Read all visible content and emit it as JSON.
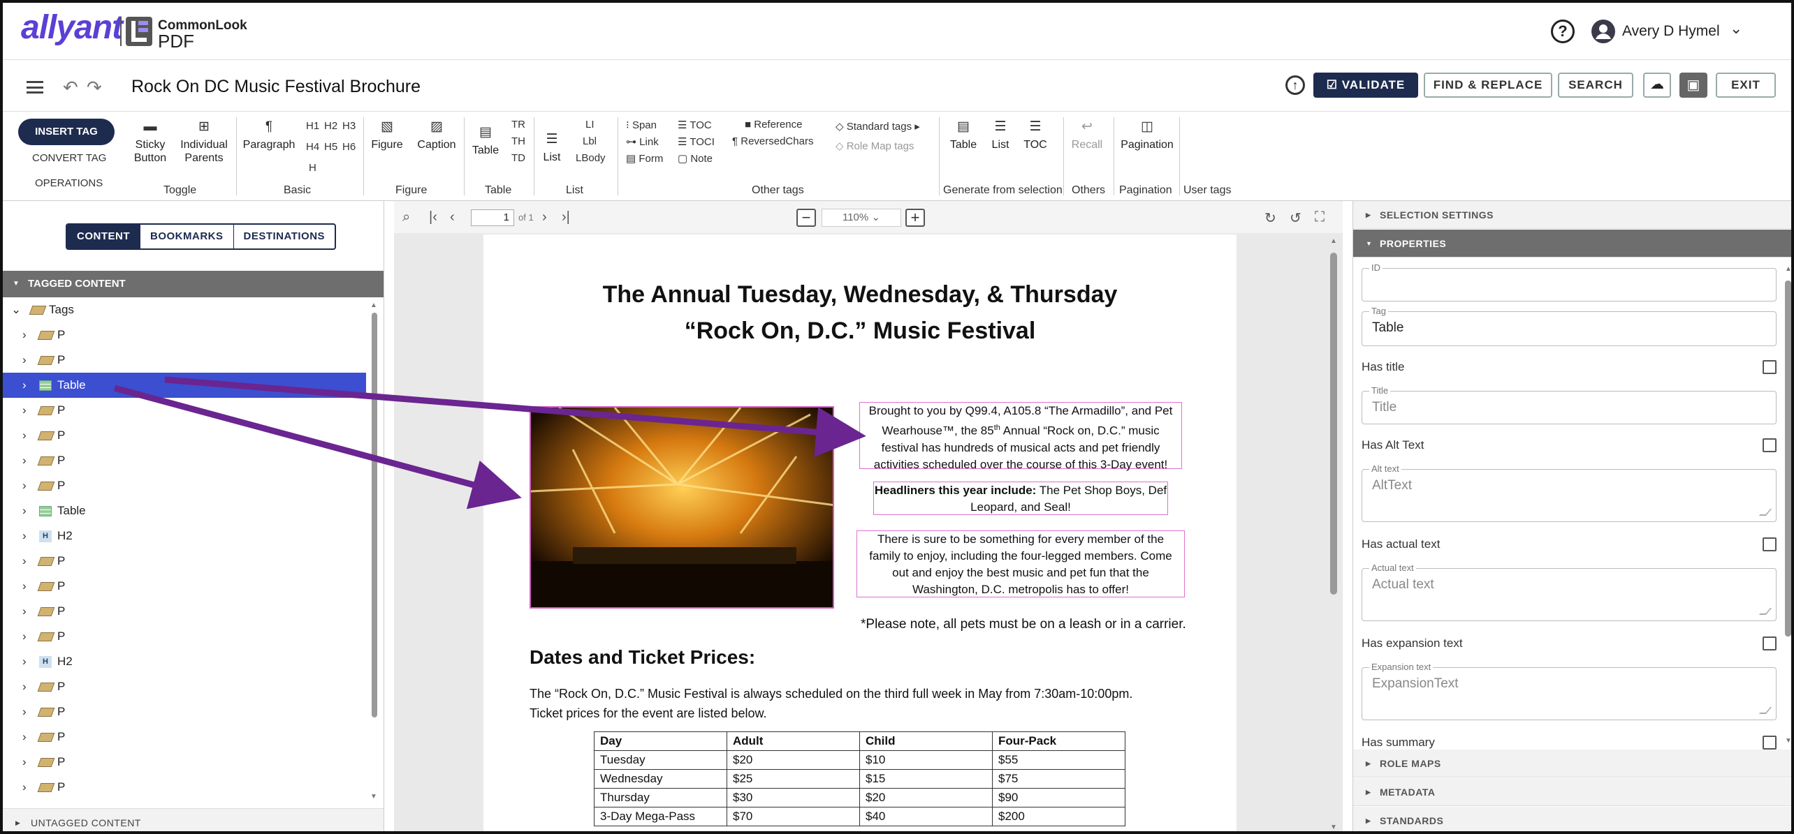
{
  "header": {
    "brand": "allyant",
    "product_top": "CommonLook",
    "product_bottom": "PDF",
    "help_icon": "help-circle-icon",
    "user_name": "Avery D Hymel"
  },
  "titlebar": {
    "doc_title": "Rock On DC Music Festival Brochure",
    "validate": "VALIDATE",
    "find_replace": "FIND & REPLACE",
    "search": "SEARCH",
    "exit": "EXIT"
  },
  "ribbon": {
    "insert_tag": "INSERT TAG",
    "convert_tag": "CONVERT TAG",
    "operations": "OPERATIONS",
    "toggle": {
      "sticky1": "Sticky",
      "sticky2": "Button",
      "indiv1": "Individual",
      "indiv2": "Parents",
      "group": "Toggle"
    },
    "basic": {
      "paragraph": "Paragraph",
      "h1": "H1",
      "h2": "H2",
      "h3": "H3",
      "h4": "H4",
      "h5": "H5",
      "h6": "H6",
      "h": "H",
      "group": "Basic"
    },
    "figure": {
      "figure": "Figure",
      "caption": "Caption",
      "group": "Figure"
    },
    "table": {
      "table": "Table",
      "tr": "TR",
      "th": "TH",
      "td": "TD",
      "group": "Table"
    },
    "list": {
      "list": "List",
      "li": "LI",
      "lbl": "Lbl",
      "lbody": "LBody",
      "group": "List"
    },
    "other": {
      "span": "Span",
      "link": "Link",
      "form": "Form",
      "toc": "TOC",
      "toci": "TOCI",
      "note": "Note",
      "reference": "Reference",
      "reversed": "ReversedChars",
      "standard": "Standard tags",
      "rolemap": "Role Map tags",
      "group": "Other tags"
    },
    "generate": {
      "table": "Table",
      "list": "List",
      "toc": "TOC",
      "group": "Generate from selection"
    },
    "others": {
      "recall": "Recall",
      "group": "Others"
    },
    "pagination": {
      "pagination": "Pagination",
      "group": "Pagination"
    },
    "user_tags": {
      "group": "User tags"
    }
  },
  "left": {
    "tabs": [
      "CONTENT",
      "BOOKMARKS",
      "DESTINATIONS"
    ],
    "tagged": "TAGGED CONTENT",
    "untagged": "UNTAGGED CONTENT",
    "tree": [
      {
        "label": "Tags",
        "kind": "root"
      },
      {
        "label": "P",
        "kind": "tag"
      },
      {
        "label": "P",
        "kind": "tag"
      },
      {
        "label": "Table",
        "kind": "table",
        "selected": true
      },
      {
        "label": "P",
        "kind": "tag"
      },
      {
        "label": "P",
        "kind": "tag"
      },
      {
        "label": "P",
        "kind": "tag"
      },
      {
        "label": "P",
        "kind": "tag"
      },
      {
        "label": "Table",
        "kind": "table"
      },
      {
        "label": "H2",
        "kind": "h"
      },
      {
        "label": "P",
        "kind": "tag"
      },
      {
        "label": "P",
        "kind": "tag"
      },
      {
        "label": "P",
        "kind": "tag"
      },
      {
        "label": "P",
        "kind": "tag"
      },
      {
        "label": "H2",
        "kind": "h"
      },
      {
        "label": "P",
        "kind": "tag"
      },
      {
        "label": "P",
        "kind": "tag"
      },
      {
        "label": "P",
        "kind": "tag"
      },
      {
        "label": "P",
        "kind": "tag"
      },
      {
        "label": "P",
        "kind": "tag"
      }
    ]
  },
  "viewer": {
    "page": "1",
    "of": "of 1",
    "zoom": "110%"
  },
  "doc": {
    "title1": "The Annual Tuesday, Wednesday, & Thursday",
    "title2": "“Rock On, D.C.” Music Festival",
    "p1a": "Brought to you by Q99.4, A105.8 “The Armadillo”, and Pet",
    "p1b": "Wearhouse™, the 85",
    "p1b_sup": "th",
    "p1b_end": " Annual “Rock on, D.C.” music",
    "p1c": "festival has hundreds of musical acts and pet friendly",
    "p1d": "activities scheduled over the course of this 3-Day event!",
    "p2_bold": "Headliners this year include:",
    "p2a": " The Pet Shop Boys, Def",
    "p2b": "Leopard, and Seal!",
    "p3a": "There is sure to be something for every member of the",
    "p3b": "family to enjoy, including the four-legged members.  Come",
    "p3c": "out and enjoy the best music and pet fun that the",
    "p3d": "Washington, D.C. metropolis has to offer!",
    "note": "*Please note, all pets must be on a leash or in a carrier.",
    "h2": "Dates and Ticket Prices:",
    "body1": "The “Rock On, D.C.” Music Festival is always scheduled on the third full week in May from 7:30am-10:00pm.",
    "body2": "Ticket prices for the event are listed below.",
    "table": [
      [
        "Day",
        "Adult",
        "Child",
        "Four-Pack"
      ],
      [
        "Tuesday",
        "$20",
        "$10",
        "$55"
      ],
      [
        "Wednesday",
        "$25",
        "$15",
        "$75"
      ],
      [
        "Thursday",
        "$30",
        "$20",
        "$90"
      ],
      [
        "3-Day Mega-Pass",
        "$70",
        "$40",
        "$200"
      ]
    ]
  },
  "right": {
    "selection": "SELECTION SETTINGS",
    "properties": "PROPERTIES",
    "id_label": "ID",
    "tag_label": "Tag",
    "tag_value": "Table",
    "has_title": "Has title",
    "title_label": "Title",
    "title_ph": "Title",
    "has_alt": "Has Alt Text",
    "alt_label": "Alt text",
    "alt_ph": "AltText",
    "has_actual": "Has actual text",
    "actual_label": "Actual text",
    "actual_ph": "Actual text",
    "has_exp": "Has expansion text",
    "exp_label": "Expansion text",
    "exp_ph": "ExpansionText",
    "has_summary": "Has summary",
    "role_maps": "ROLE MAPS",
    "metadata": "METADATA",
    "standards": "STANDARDS"
  },
  "colors": {
    "brand": "#5b3fd6",
    "navy": "#1d2b4f",
    "selection": "#3c4fd0",
    "arrow": "#6a2590",
    "highlight_box": "#e070d0"
  }
}
